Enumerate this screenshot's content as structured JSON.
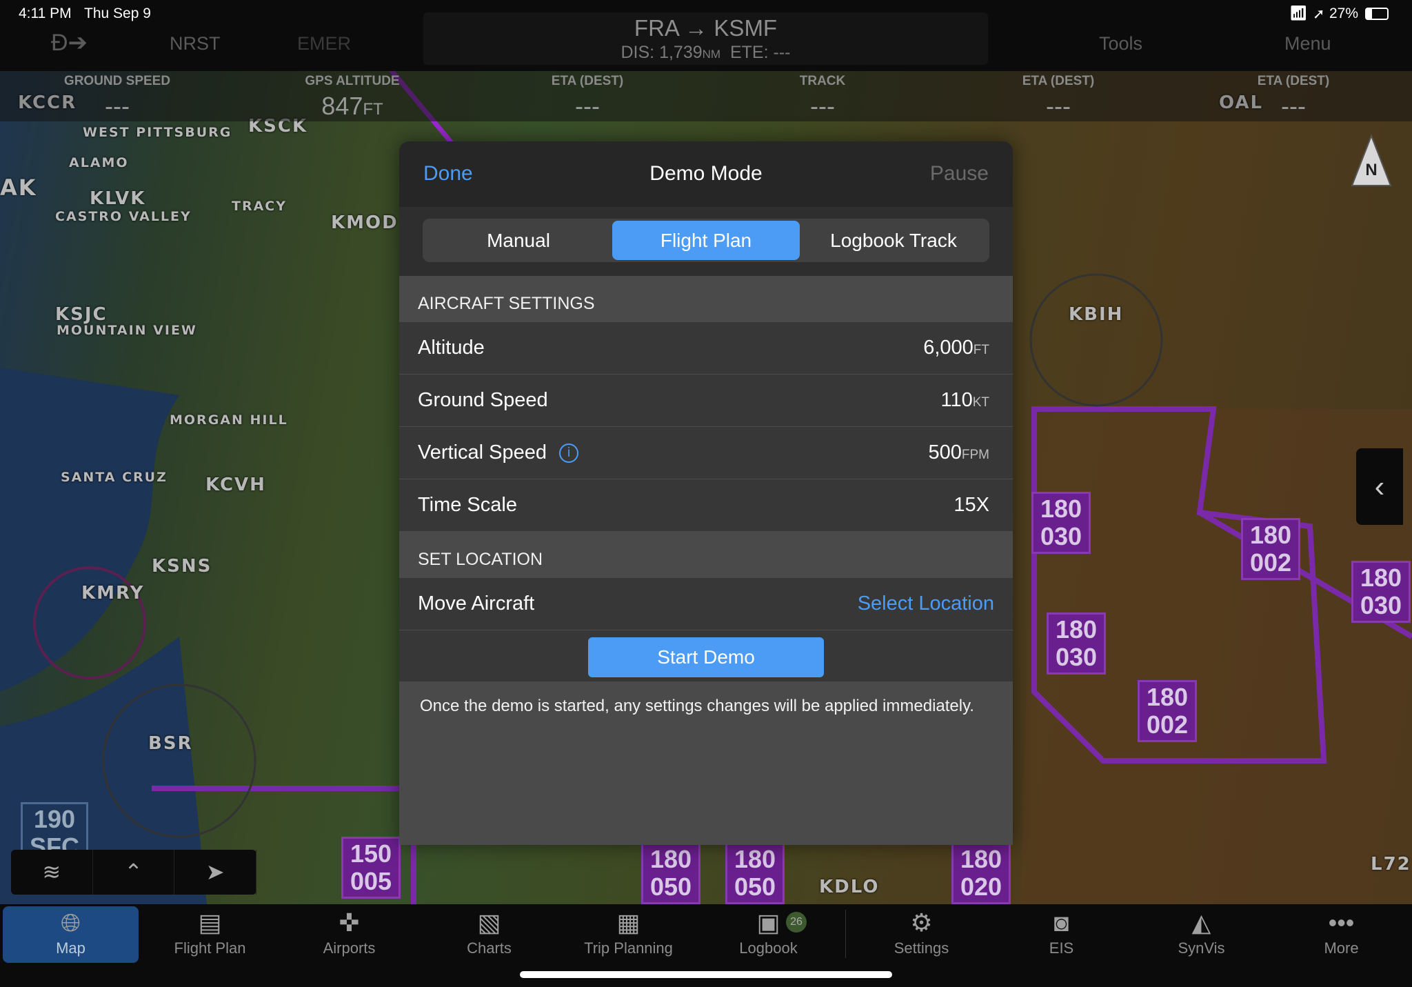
{
  "status_bar": {
    "time": "4:11 PM",
    "date": "Thu Sep 9",
    "battery": "27%"
  },
  "top_nav": {
    "direct_to_icon": "direct-to-icon",
    "nrst": "NRST",
    "emer": "EMER",
    "tools": "Tools",
    "menu": "Menu",
    "route": "FRA → KSMF",
    "dis_label": "DIS:",
    "dis_value": "1,739",
    "dis_unit": "NM",
    "ete_label": "ETE:",
    "ete_value": "---"
  },
  "data_strip": [
    {
      "label": "GROUND SPEED",
      "value": "---",
      "unit": ""
    },
    {
      "label": "GPS ALTITUDE",
      "value": "847",
      "unit": "FT"
    },
    {
      "label": "ETA (DEST)",
      "value": "---",
      "unit": ""
    },
    {
      "label": "TRACK",
      "value": "---",
      "unit": ""
    },
    {
      "label": "ETA (DEST)",
      "value": "---",
      "unit": ""
    },
    {
      "label": "ETA (DEST)",
      "value": "---",
      "unit": ""
    }
  ],
  "map": {
    "labels": [
      "KSCK",
      "KLVK",
      "KMOD",
      "KSJC",
      "KCVH",
      "KSNS",
      "KMRY",
      "BSR",
      "KBIH",
      "KDLO",
      "MORGAN HILL",
      "SANTA CRUZ",
      "TRACY",
      "CASTRO VALLEY",
      "MOUNTAIN VIEW",
      "ALAMO",
      "KCCR",
      "WEST PITTSBURG",
      "OAL",
      "L72",
      "AK"
    ],
    "moa": [
      {
        "top": "180",
        "bottom": "030"
      },
      {
        "top": "180",
        "bottom": "002"
      },
      {
        "top": "180",
        "bottom": "030"
      },
      {
        "top": "180",
        "bottom": "030"
      },
      {
        "top": "180",
        "bottom": "002"
      },
      {
        "top": "150",
        "bottom": "005"
      },
      {
        "top": "180",
        "bottom": "050"
      },
      {
        "top": "180",
        "bottom": "050"
      },
      {
        "top": "180",
        "bottom": "020"
      },
      {
        "top": "190",
        "bottom": "SFC"
      }
    ],
    "compass": "N"
  },
  "modal": {
    "done": "Done",
    "title": "Demo Mode",
    "pause": "Pause",
    "segments": [
      "Manual",
      "Flight Plan",
      "Logbook Track"
    ],
    "selected_segment": "Flight Plan",
    "aircraft_settings": "AIRCRAFT SETTINGS",
    "rows": [
      {
        "label": "Altitude",
        "value": "6,000",
        "unit": "FT"
      },
      {
        "label": "Ground Speed",
        "value": "110",
        "unit": "KT"
      },
      {
        "label": "Vertical Speed",
        "value": "500",
        "unit": "FPM"
      },
      {
        "label": "Time Scale",
        "value": "15X",
        "unit": ""
      }
    ],
    "set_location": "SET LOCATION",
    "move_aircraft": "Move Aircraft",
    "select_location": "Select Location",
    "start_demo": "Start Demo",
    "note": "Once the demo is started, any settings changes will be applied immediately."
  },
  "tabs": [
    {
      "label": "Map",
      "icon": "globe-icon",
      "active": true
    },
    {
      "label": "Flight Plan",
      "icon": "flight-plan-icon"
    },
    {
      "label": "Airports",
      "icon": "airport-icon"
    },
    {
      "label": "Charts",
      "icon": "charts-icon"
    },
    {
      "label": "Trip Planning",
      "icon": "trip-planning-icon"
    },
    {
      "label": "Logbook",
      "icon": "logbook-icon",
      "badge": "26"
    },
    {
      "label": "Settings",
      "icon": "gear-icon"
    },
    {
      "label": "EIS",
      "icon": "eis-icon"
    },
    {
      "label": "SynVis",
      "icon": "synvis-icon"
    },
    {
      "label": "More",
      "icon": "more-icon"
    }
  ],
  "colors": {
    "accent": "#4c9cf5",
    "moa": "#6a1f8e",
    "active_tab": "#1d4a82"
  }
}
